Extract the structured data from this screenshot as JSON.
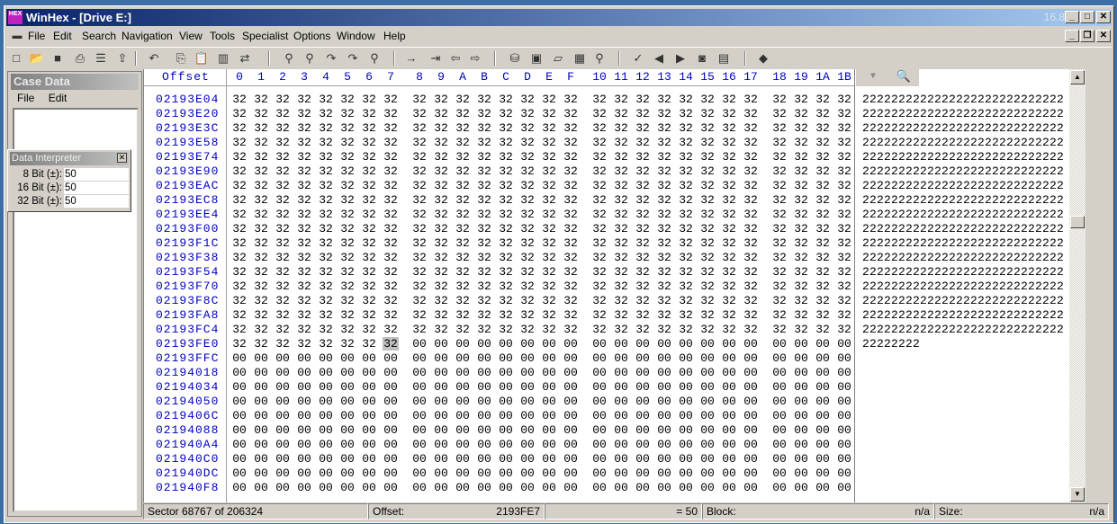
{
  "window": {
    "title": "WinHex - [Drive E:]",
    "version": "16.8",
    "app_icon_text": "HEX"
  },
  "menu": [
    "File",
    "Edit",
    "Search",
    "Navigation",
    "View",
    "Tools",
    "Specialist",
    "Options",
    "Window",
    "Help"
  ],
  "case_data": {
    "title": "Case Data",
    "menu": [
      "File",
      "Edit"
    ]
  },
  "interpreter": {
    "title": "Data Interpreter",
    "rows": [
      {
        "label": "8 Bit (±):",
        "value": "50"
      },
      {
        "label": "16 Bit (±):",
        "value": "50"
      },
      {
        "label": "32 Bit (±):",
        "value": "50"
      }
    ]
  },
  "hex": {
    "offset_header": "Offset",
    "columns": [
      "0",
      "1",
      "2",
      "3",
      "4",
      "5",
      "6",
      "7",
      "8",
      "9",
      "A",
      "B",
      "C",
      "D",
      "E",
      "F",
      "10",
      "11",
      "12",
      "13",
      "14",
      "15",
      "16",
      "17",
      "18",
      "19",
      "1A",
      "1B"
    ],
    "selected": {
      "row": 18,
      "col": 7
    },
    "rows": [
      {
        "offset": "02193E04",
        "fill": "32",
        "count": 28,
        "text": "2222222222222222222222222222"
      },
      {
        "offset": "02193E20",
        "fill": "32",
        "count": 28,
        "text": "2222222222222222222222222222"
      },
      {
        "offset": "02193E3C",
        "fill": "32",
        "count": 28,
        "text": "2222222222222222222222222222"
      },
      {
        "offset": "02193E58",
        "fill": "32",
        "count": 28,
        "text": "2222222222222222222222222222"
      },
      {
        "offset": "02193E74",
        "fill": "32",
        "count": 28,
        "text": "2222222222222222222222222222"
      },
      {
        "offset": "02193E90",
        "fill": "32",
        "count": 28,
        "text": "2222222222222222222222222222"
      },
      {
        "offset": "02193EAC",
        "fill": "32",
        "count": 28,
        "text": "2222222222222222222222222222"
      },
      {
        "offset": "02193EC8",
        "fill": "32",
        "count": 28,
        "text": "2222222222222222222222222222"
      },
      {
        "offset": "02193EE4",
        "fill": "32",
        "count": 28,
        "text": "2222222222222222222222222222"
      },
      {
        "offset": "02193F00",
        "fill": "32",
        "count": 28,
        "text": "2222222222222222222222222222"
      },
      {
        "offset": "02193F1C",
        "fill": "32",
        "count": 28,
        "text": "2222222222222222222222222222"
      },
      {
        "offset": "02193F38",
        "fill": "32",
        "count": 28,
        "text": "2222222222222222222222222222"
      },
      {
        "offset": "02193F54",
        "fill": "32",
        "count": 28,
        "text": "2222222222222222222222222222"
      },
      {
        "offset": "02193F70",
        "fill": "32",
        "count": 28,
        "text": "2222222222222222222222222222"
      },
      {
        "offset": "02193F8C",
        "fill": "32",
        "count": 28,
        "text": "2222222222222222222222222222"
      },
      {
        "offset": "02193FA8",
        "fill": "32",
        "count": 28,
        "text": "2222222222222222222222222222"
      },
      {
        "offset": "02193FC4",
        "fill": "32",
        "count": 28,
        "text": "2222222222222222222222222222"
      },
      {
        "offset": "02193FE0",
        "fill": "32",
        "count": 8,
        "text": "22222222"
      },
      {
        "offset": "02193FFC",
        "fill": "32",
        "count": 0,
        "text": ""
      },
      {
        "offset": "02194018",
        "fill": "32",
        "count": 0,
        "text": ""
      },
      {
        "offset": "02194034",
        "fill": "32",
        "count": 0,
        "text": ""
      },
      {
        "offset": "02194050",
        "fill": "32",
        "count": 0,
        "text": ""
      },
      {
        "offset": "0219406C",
        "fill": "32",
        "count": 0,
        "text": ""
      },
      {
        "offset": "02194088",
        "fill": "32",
        "count": 0,
        "text": ""
      },
      {
        "offset": "021940A4",
        "fill": "32",
        "count": 0,
        "text": ""
      },
      {
        "offset": "021940C0",
        "fill": "32",
        "count": 0,
        "text": ""
      },
      {
        "offset": "021940DC",
        "fill": "32",
        "count": 0,
        "text": ""
      },
      {
        "offset": "021940F8",
        "fill": "32",
        "count": 0,
        "text": ""
      }
    ]
  },
  "status": {
    "sector": "Sector 68767 of 206324",
    "offset_label": "Offset:",
    "offset_value": "2193FE7",
    "value": "= 50",
    "block_label": "Block:",
    "block_value": "n/a",
    "size_label": "Size:",
    "size_value": "n/a"
  }
}
